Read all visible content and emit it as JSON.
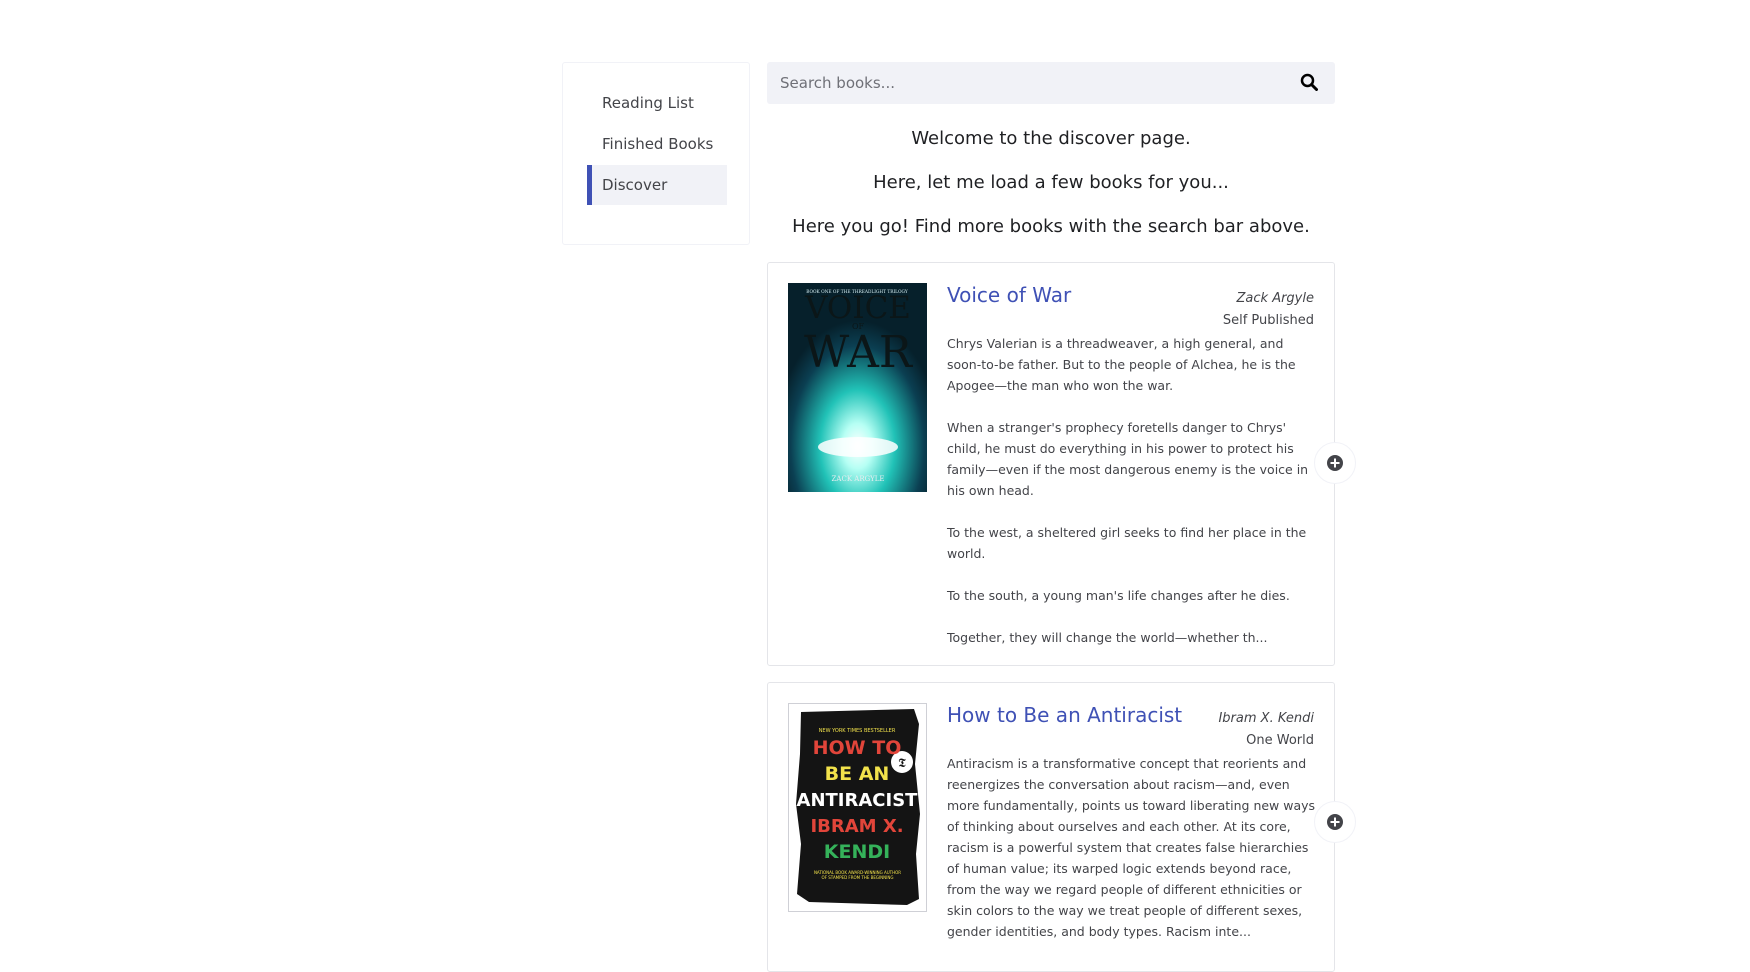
{
  "nav": {
    "items": [
      {
        "label": "Reading List"
      },
      {
        "label": "Finished Books"
      },
      {
        "label": "Discover"
      }
    ]
  },
  "search": {
    "placeholder": "Search books..."
  },
  "messages": {
    "welcome": "Welcome to the discover page.",
    "loading": "Here, let me load a few books for you...",
    "done": "Here you go! Find more books with the search bar above."
  },
  "books": [
    {
      "title": "Voice of War",
      "author": "Zack Argyle",
      "publisher": "Self Published",
      "synopsis": "Chrys Valerian is a threadweaver, a high general, and soon-to-be father. But to the people of Alchea, he is the Apogee—the man who won the war.\n\nWhen a stranger's prophecy foretells danger to Chrys' child, he must do everything in his power to protect his family—even if the most dangerous enemy is the voice in his own head.\n\nTo the west, a sheltered girl seeks to find her place in the world.\n\nTo the south, a young man's life changes after he dies.\n\nTogether, they will change the world—whether th...",
      "cover": {
        "series": "BOOK ONE OF THE THREADLIGHT TRILOGY",
        "line1": "VOICE",
        "line2": "OF",
        "line3": "WAR",
        "author": "ZACK ARGYLE"
      }
    },
    {
      "title": "How to Be an Antiracist",
      "author": "Ibram X. Kendi",
      "publisher": "One World",
      "synopsis": "Antiracism is a transformative concept that reorients and reenergizes the conversation about racism—and, even more fundamentally, points us toward liberating new ways of thinking about ourselves and each other. At its core, racism is a powerful system that creates false hierarchies of human value; its warped logic extends beyond race, from the way we regard people of different ethnicities or skin colors to the way we treat people of different sexes, gender identities, and body types. Racism inte...",
      "cover": {
        "top": "NEW YORK TIMES BESTSELLER",
        "line1": "HOW TO",
        "line2": "BE AN",
        "line3": "ANTIRACIST",
        "line4": "IBRAM X.",
        "line5": "KENDI",
        "bottom": "NATIONAL BOOK AWARD-WINNING AUTHOR OF STAMPED FROM THE BEGINNING"
      }
    }
  ],
  "colors": {
    "accent": "#3f51b5",
    "panel": "#f1f2f7",
    "border": "#e4e5e9"
  }
}
